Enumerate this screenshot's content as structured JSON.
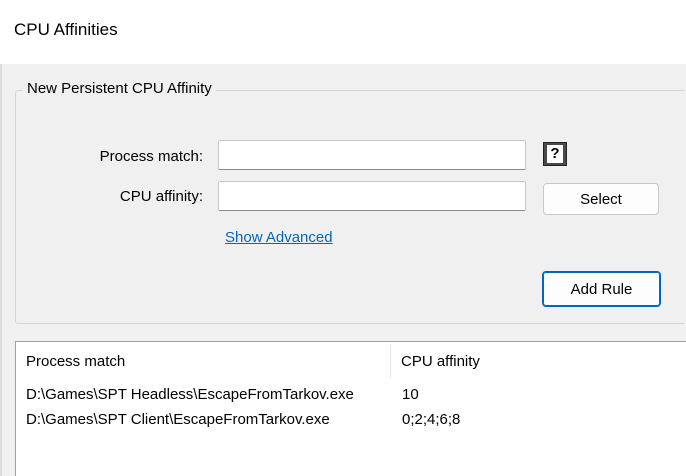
{
  "window": {
    "title": "CPU Affinities"
  },
  "group": {
    "legend": "New Persistent CPU Affinity",
    "process_match_label": "Process match:",
    "process_match_value": "",
    "cpu_affinity_label": "CPU affinity:",
    "cpu_affinity_value": "",
    "help_icon_glyph": "?",
    "select_button": "Select",
    "show_advanced_link": "Show Advanced",
    "add_rule_button": "Add Rule"
  },
  "table": {
    "columns": [
      "Process match",
      "CPU affinity"
    ],
    "rows": [
      {
        "process": "D:\\Games\\SPT Headless\\EscapeFromTarkov.exe",
        "affinity": "10"
      },
      {
        "process": "D:\\Games\\SPT Client\\EscapeFromTarkov.exe",
        "affinity": "0;2;4;6;8"
      }
    ]
  }
}
